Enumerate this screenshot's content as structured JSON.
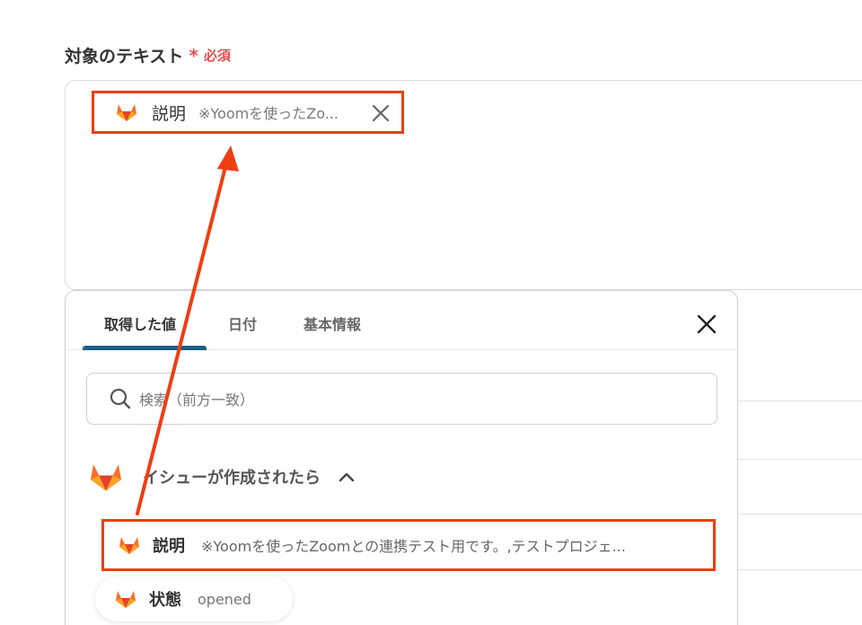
{
  "field": {
    "label": "対象のテキスト",
    "required_mark": "*",
    "required_text": "必須"
  },
  "selected_chip": {
    "icon": "gitlab-icon",
    "label": "説明",
    "value": "※Yoomを使ったZo..."
  },
  "popup": {
    "tabs": [
      {
        "label": "取得した値"
      },
      {
        "label": "日付"
      },
      {
        "label": "基本情報"
      }
    ],
    "active_tab": "取得した値",
    "search": {
      "placeholder": "検索（前方一致）",
      "icon": "search-icon"
    },
    "group": {
      "icon": "gitlab-icon",
      "label": "イシューが作成されたら",
      "expanded": true
    },
    "items": [
      {
        "label": "説明",
        "value": "※Yoomを使ったZoomとの連携テスト用です。,テストプロジェ..."
      },
      {
        "label": "状態",
        "value": "opened"
      }
    ]
  },
  "colors": {
    "highlight": "#f03d11",
    "required": "#e0514f",
    "tab_underline": "#1d5f82",
    "gitlab_orange": "#fc6d26"
  }
}
